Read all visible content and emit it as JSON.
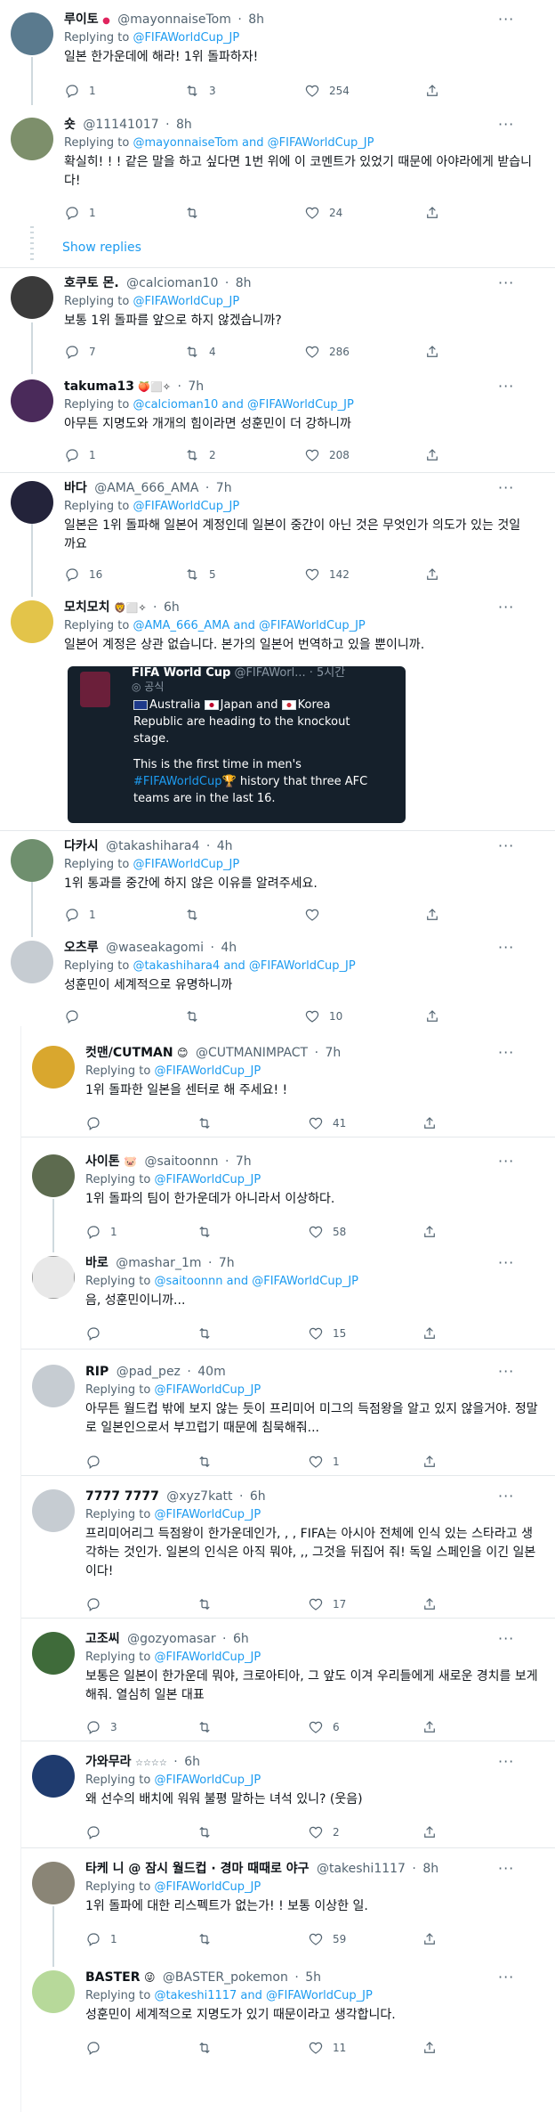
{
  "common": {
    "replying_to": "Replying to ",
    "and": " and ",
    "dot": "·",
    "more": "···"
  },
  "show_replies": "Show replies",
  "tweets": [
    {
      "name": "루이토",
      "badge": "●",
      "handle": "@mayonnaiseTom",
      "time": "8h",
      "replying": [
        "@FIFAWorldCup_JP"
      ],
      "text": "일본 한가운데에 해라! 1위 돌파하자!",
      "replies": "1",
      "retweets": "3",
      "likes": "254"
    },
    {
      "name": "숏",
      "handle": "@11141017",
      "time": "8h",
      "replying": [
        "@mayonnaiseTom",
        "@FIFAWorldCup_JP"
      ],
      "text": "확실히! ! ! 같은 말을 하고 싶다면 1번 위에 이 코멘트가 있었기 때문에 아야라에게 받습니다!",
      "replies": "1",
      "retweets": "",
      "likes": "24"
    },
    {
      "name": "호쿠토 몬.",
      "handle": "@calcioman10",
      "time": "8h",
      "replying": [
        "@FIFAWorldCup_JP"
      ],
      "text": "보통 1위 돌파를 앞으로 하지 않겠습니까?",
      "replies": "7",
      "retweets": "4",
      "likes": "286"
    },
    {
      "name": "takuma13",
      "badge": "🍑⬜✧",
      "handle": "",
      "time": "7h",
      "replying": [
        "@calcioman10",
        "@FIFAWorldCup_JP"
      ],
      "text": "아무튼 지명도와 개개의 힘이라면 성훈민이 더 강하니까",
      "replies": "1",
      "retweets": "2",
      "likes": "208"
    },
    {
      "name": "바다",
      "handle": "@AMA_666_AMA",
      "time": "7h",
      "replying": [
        "@FIFAWorldCup_JP"
      ],
      "text": "일본은 1위 돌파해 일본어 계정인데 일본이 중간이 아닌 것은 무엇인가 의도가 있는 것일까요",
      "replies": "16",
      "retweets": "5",
      "likes": "142"
    },
    {
      "name": "모치모치",
      "badge": "🦁⬜✧",
      "handle": "",
      "time": "6h",
      "replying": [
        "@AMA_666_AMA",
        "@FIFAWorldCup_JP"
      ],
      "text": "일본어 계정은 상관 없습니다. 본가의 일본어 번역하고 있을 뿐이니까.",
      "replies": "",
      "retweets": "",
      "likes": "",
      "embed": {
        "header": "FIFA World Cup",
        "header_rest": "@FIFAWorl... · 5시간",
        "official": "◎ 공식",
        "line1_a": "Australia",
        "line1_b": "Japan and",
        "line1_c": "Korea",
        "line2": "Republic are heading to the knockout",
        "line3": "stage.",
        "line4": "This is the first time in men's",
        "hashtag": "#FIFAWorldCup",
        "line5_rest": " history that three AFC",
        "line6": "teams are in the last 16."
      }
    },
    {
      "name": "다카시",
      "handle": "@takashihara4",
      "time": "4h",
      "replying": [
        "@FIFAWorldCup_JP"
      ],
      "text": "1위 통과를 중간에 하지 않은 이유를 알려주세요.",
      "replies": "1",
      "retweets": "",
      "likes": ""
    },
    {
      "name": "오츠루",
      "handle": "@waseakagomi",
      "time": "4h",
      "replying": [
        "@takashihara4",
        "@FIFAWorldCup_JP"
      ],
      "text": "성훈민이 세계적으로 유명하니까",
      "replies": "",
      "retweets": "",
      "likes": "10"
    },
    {
      "name": "컷맨/CUTMAN",
      "badge": "😊",
      "handle": "@CUTMANIMPACT",
      "time": "7h",
      "replying": [
        "@FIFAWorldCup_JP"
      ],
      "text": "1위 돌파한 일본을 센터로 해 주세요! !",
      "replies": "",
      "retweets": "",
      "likes": "41"
    },
    {
      "name": "사이톤",
      "badge": "🐷",
      "handle": "@saitoonnn",
      "time": "7h",
      "replying": [
        "@FIFAWorldCup_JP"
      ],
      "text": "1위 돌파의 팀이 한가운데가 아니라서 이상하다.",
      "replies": "1",
      "retweets": "",
      "likes": "58"
    },
    {
      "name": "바로",
      "handle": "@mashar_1m",
      "time": "7h",
      "replying": [
        "@saitoonnn",
        "@FIFAWorldCup_JP"
      ],
      "text": "음, 성훈민이니까...",
      "replies": "",
      "retweets": "",
      "likes": "15"
    },
    {
      "name": "RIP",
      "handle": "@pad_pez",
      "time": "40m",
      "replying": [
        "@FIFAWorldCup_JP"
      ],
      "text": "아무튼 월드컵 밖에 보지 않는 듯이 프리미어 미그의 득점왕을 알고 있지 않을거야. 정말로 일본인으로서 부끄럽기 때문에 침묵해줘...",
      "replies": "",
      "retweets": "",
      "likes": "1"
    },
    {
      "name": "7777 7777",
      "handle": "@xyz7katt",
      "time": "6h",
      "replying": [
        "@FIFAWorldCup_JP"
      ],
      "text": "프리미어리그 득점왕이 한가운데인가, , , FIFA는 아시아 전체에 인식 있는 스타라고 생각하는 것인가. 일본의 인식은 아직 뭐야, ,, 그것을 뒤집어 줘! 독일 스페인을 이긴 일본이다!",
      "replies": "",
      "retweets": "",
      "likes": "17"
    },
    {
      "name": "고조씨",
      "handle": "@gozyomasar",
      "time": "6h",
      "replying": [
        "@FIFAWorldCup_JP"
      ],
      "text": "보통은 일본이 한가운데 뭐야, 크로아티아, 그 앞도 이겨 우리들에게 새로운 경치를 보게 해줘. 열심히 일본 대표",
      "replies": "3",
      "retweets": "",
      "likes": "6"
    },
    {
      "name": "가와무라",
      "badge": "☆☆☆☆",
      "handle": "",
      "time": "6h",
      "replying": [
        "@FIFAWorldCup_JP"
      ],
      "text": "왜 선수의 배치에 워워 불평 말하는 녀석 있니? (웃음)",
      "replies": "",
      "retweets": "",
      "likes": "2"
    },
    {
      "name": "타케 니 @ 잠시 월드컵 · 경마 때때로 야구",
      "handle": "@takeshi1117",
      "time": "8h",
      "replying": [
        "@FIFAWorldCup_JP"
      ],
      "text": "1위 돌파에 대한 리스펙트가 없는가! ! 보통 이상한 일.",
      "replies": "1",
      "retweets": "",
      "likes": "59"
    },
    {
      "name": "BASTER",
      "badge": "😜",
      "handle": "@BASTER_pokemon",
      "time": "5h",
      "replying": [
        "@takeshi1117",
        "@FIFAWorldCup_JP"
      ],
      "text": "성훈민이 세계적으로 지명도가 있기 때문이라고 생각합니다.",
      "replies": "",
      "retweets": "",
      "likes": "11"
    }
  ],
  "colors": {
    "link": "#1d9bf0",
    "secondary": "#536471",
    "text": "#0f1419",
    "divider": "#e4e8eb",
    "embed_bg": "#15202b"
  }
}
